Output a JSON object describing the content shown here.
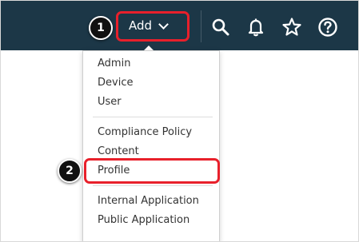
{
  "topbar": {
    "add_label": "Add",
    "icons": [
      "search-icon",
      "bell-icon",
      "star-icon",
      "help-icon"
    ]
  },
  "callouts": {
    "step1": "1",
    "step2": "2"
  },
  "menu": {
    "group1": [
      "Admin",
      "Device",
      "User"
    ],
    "group2": [
      "Compliance Policy",
      "Content",
      "Profile"
    ],
    "group3": [
      "Internal Application",
      "Public Application"
    ]
  },
  "colors": {
    "topbar_bg": "#1c3747",
    "highlight": "#e8202b",
    "menu_text": "#333333"
  }
}
